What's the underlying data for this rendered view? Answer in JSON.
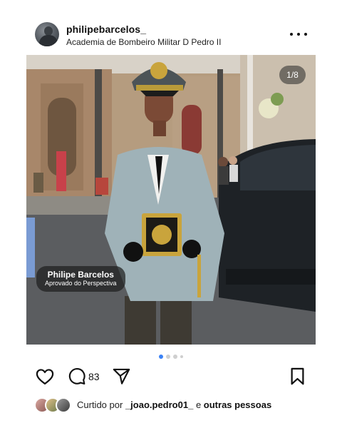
{
  "post": {
    "username": "philipebarcelos_",
    "location": "Academia de Bombeiro Militar D Pedro II",
    "image_counter": "1/8",
    "overlay": {
      "name": "Philipe Barcelos",
      "subtitle": "Aprovado do Perspectiva"
    },
    "carousel": {
      "current": 1,
      "total_dots_visible": 4
    },
    "actions": {
      "comment_count": "83"
    },
    "likes": {
      "prefix": "Curtido por",
      "user": "_joao.pedro01_",
      "middle": "e",
      "suffix": "outras pessoas"
    }
  },
  "icons": {
    "more": "more-horizontal-icon",
    "like": "heart-icon",
    "comment": "comment-icon",
    "share": "send-icon",
    "save": "bookmark-icon"
  },
  "colors": {
    "text": "#111111",
    "active_dot": "#3b82f6",
    "inactive_dot": "#cfcfcf",
    "overlay_bg": "rgba(30,30,30,0.72)"
  }
}
